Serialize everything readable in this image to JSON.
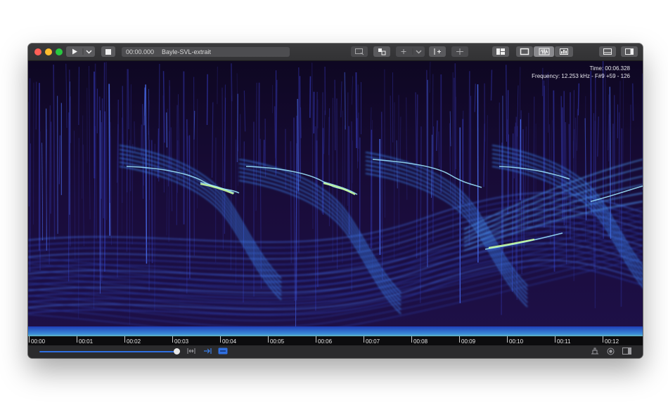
{
  "toolbar": {
    "time": "00:00.000",
    "file_name": "Bayle-SVL-extrait"
  },
  "readout": {
    "time": "Time: 00:06.328",
    "frequency": "Frequency: 12.253 kHz - F#9 +59 - 126"
  },
  "timeline": {
    "ticks": [
      "00:00",
      "00:01",
      "00:02",
      "00:03",
      "00:04",
      "00:05",
      "00:06",
      "00:07",
      "00:08",
      "00:09",
      "00:10",
      "00:11",
      "00:12"
    ]
  },
  "playback": {
    "progress": 0.96
  },
  "colors": {
    "accent": "#2f6fe0",
    "spectrogram_bg": "#120826",
    "spectrogram_peak": "#a8ff8c"
  }
}
